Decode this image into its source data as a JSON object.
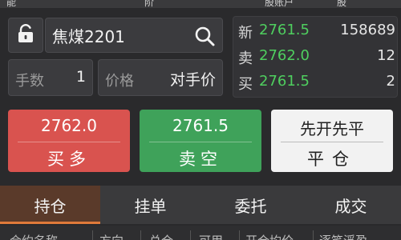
{
  "top_partial": [
    "能",
    "阶",
    "股账户",
    "股"
  ],
  "order_form": {
    "symbol": "焦煤2201",
    "qty_label": "手数",
    "qty_value": "1",
    "price_label": "价格",
    "price_value": "对手价"
  },
  "quotes": [
    {
      "label": "新",
      "price": "2761.5",
      "volume": "158689"
    },
    {
      "label": "卖",
      "price": "2762.0",
      "volume": "12"
    },
    {
      "label": "买",
      "price": "2761.5",
      "volume": "2"
    }
  ],
  "actions": {
    "buy_price": "2762.0",
    "buy_label": "买多",
    "sell_price": "2761.5",
    "sell_label": "卖空",
    "close_top": "先开先平",
    "close_label": "平仓"
  },
  "tabs": [
    "持仓",
    "挂单",
    "委托",
    "成交"
  ],
  "table_header": [
    "合约名称",
    "方向",
    "总仓",
    "可用",
    "开仓均价",
    "逐笔浮盈"
  ],
  "colors": {
    "background": "#2a2a2c",
    "buy": "#d9534f",
    "sell": "#3fa25a",
    "price_green": "#4fcf5f",
    "tab_active": "#5a3a2a"
  }
}
